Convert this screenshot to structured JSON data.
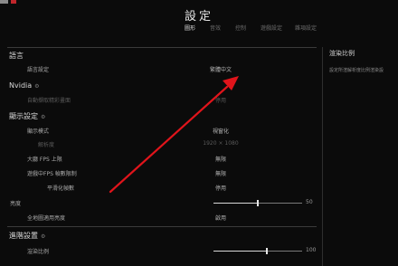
{
  "header": {
    "title": "設定"
  },
  "tabs": [
    {
      "label": "圖形",
      "active": true
    },
    {
      "label": "音效",
      "active": false
    },
    {
      "label": "控制",
      "active": false
    },
    {
      "label": "遊戲設定",
      "active": false
    },
    {
      "label": "雜項設定",
      "active": false
    }
  ],
  "sections": {
    "language": {
      "title": "語言",
      "rows": [
        {
          "label": "語言設定",
          "value": "繁體中文"
        }
      ]
    },
    "nvidia": {
      "title": "Nvidia",
      "rows": [
        {
          "label": "自動擷取精彩畫面",
          "value": "停用"
        }
      ]
    },
    "display": {
      "title": "顯示設定",
      "rows": [
        {
          "label": "顯示模式",
          "value": "視窗化"
        },
        {
          "label": "解析度",
          "value": "1920 × 1080"
        },
        {
          "label": "大廳 FPS 上限",
          "value": "無限"
        },
        {
          "label": "遊戲中FPS 幀數限制",
          "value": "無限"
        },
        {
          "label": "平滑化幀數",
          "value": "停用"
        },
        {
          "label": "亮度",
          "value": "50"
        },
        {
          "label": "全地圖適用亮度",
          "value": "啟用"
        }
      ]
    },
    "advanced": {
      "title": "進階設置",
      "rows": [
        {
          "label": "渲染比例",
          "value": "100"
        }
      ]
    }
  },
  "sliders": {
    "brightness_fraction": 0.5,
    "render_scale_fraction": 0.6
  },
  "right_panel": {
    "title": "渲染比例",
    "description": "設定所渲解析度比例渲染設"
  },
  "colors": {
    "background": "#0b0b0b",
    "annotation_arrow": "#e0141b",
    "accent_mark": "#c0262b"
  }
}
